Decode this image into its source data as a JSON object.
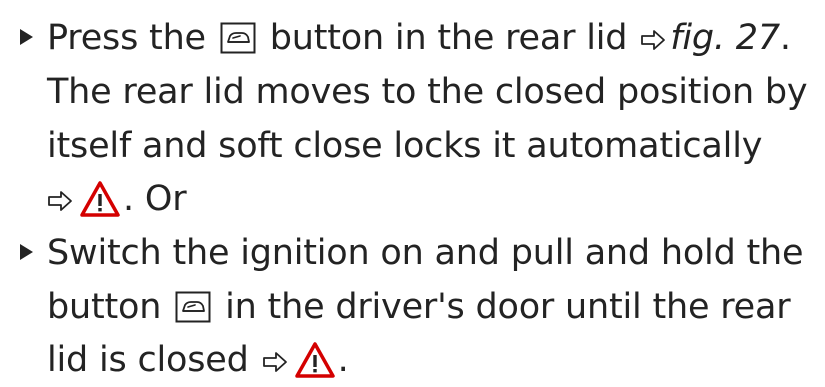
{
  "steps": [
    {
      "lines": [
        {
          "before": "Press the",
          "after": "button in the rear lid",
          "fig_ref": "fig. 27",
          "end": "."
        },
        {
          "text": "The rear lid moves to the closed position by"
        },
        {
          "text": "itself and soft close locks it automatically"
        },
        {
          "after": ". Or"
        }
      ]
    },
    {
      "lines": [
        {
          "text": "Switch the ignition on and pull and hold the"
        },
        {
          "before": "button",
          "after": "in the driver's door until the rear"
        },
        {
          "before": "lid is closed",
          "after": "."
        }
      ]
    }
  ],
  "icons": {
    "rear_lid_button": "rear-lid-close-button-icon",
    "reference_arrow": "reference-arrow-icon",
    "warning": "warning-triangle-icon",
    "warning_color": "#d40000",
    "text_color": "#232323"
  }
}
